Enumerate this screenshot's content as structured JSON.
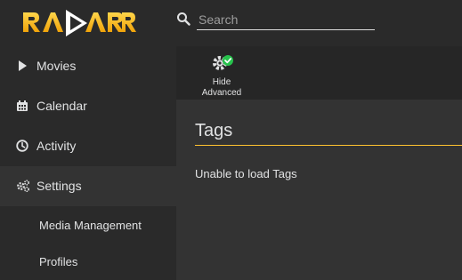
{
  "header": {
    "logo_text": "RADARR",
    "search": {
      "placeholder": "Search",
      "value": ""
    }
  },
  "colors": {
    "accent": "#ffc230",
    "header_bg": "#2a2a2a",
    "sidebar_bg": "#2a2a2a",
    "content_bg": "#333333",
    "check": "#27c24c"
  },
  "sidebar": {
    "items": [
      {
        "label": "Movies",
        "icon": "play-icon"
      },
      {
        "label": "Calendar",
        "icon": "calendar-icon"
      },
      {
        "label": "Activity",
        "icon": "clock-icon"
      },
      {
        "label": "Settings",
        "icon": "cogs-icon",
        "active": true
      }
    ],
    "subitems": [
      {
        "label": "Media Management"
      },
      {
        "label": "Profiles"
      }
    ]
  },
  "toolbar": {
    "advanced_line1": "Hide",
    "advanced_line2": "Advanced",
    "icon": "gear-check-icon"
  },
  "main": {
    "title": "Tags",
    "message": "Unable to load Tags"
  }
}
